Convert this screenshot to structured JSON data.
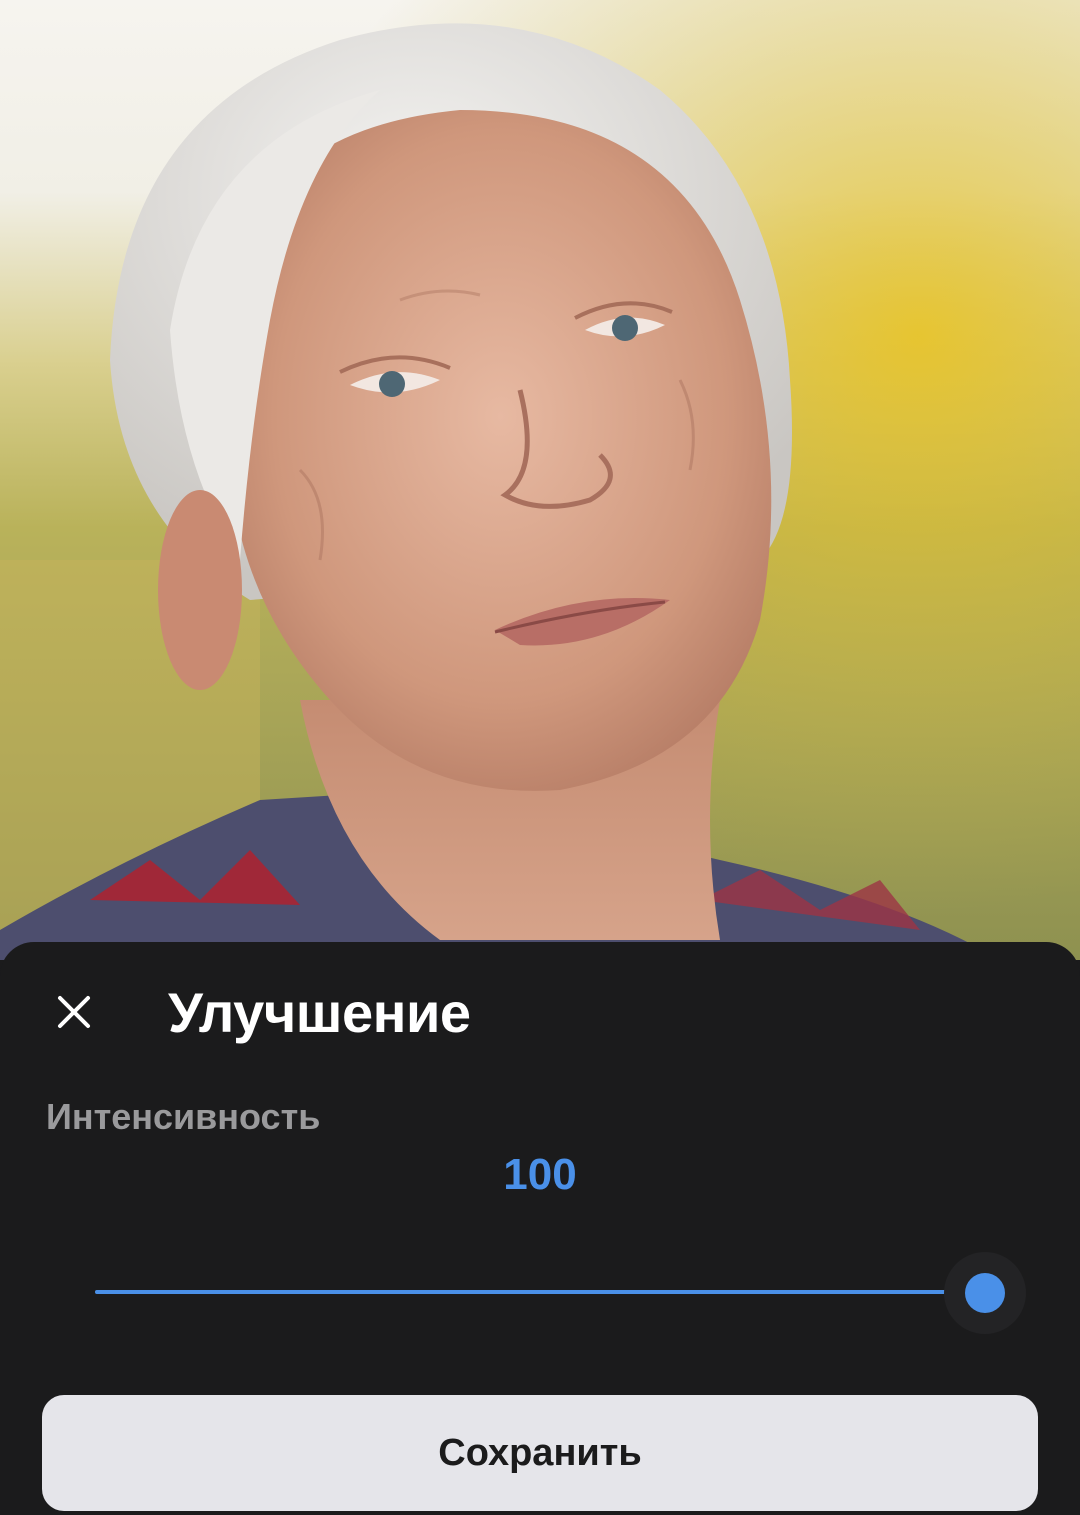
{
  "photo": {
    "subject": "portrait-photo"
  },
  "sheet": {
    "close_icon": "close-icon",
    "title": "Улучшение",
    "intensity_label": "Интенсивность",
    "intensity_value": "100",
    "slider": {
      "min": 0,
      "max": 100,
      "value": 100
    },
    "save_label": "Сохранить"
  },
  "colors": {
    "accent": "#4a90e8",
    "sheet_background": "#1b1b1c",
    "button_background": "#e5e5ea",
    "title_text": "#ffffff",
    "label_text": "#9a9a9c"
  }
}
